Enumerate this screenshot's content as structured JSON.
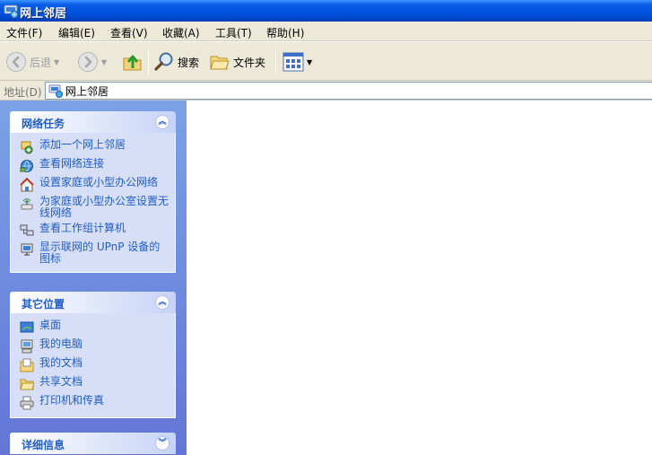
{
  "window": {
    "title": "网上邻居"
  },
  "menu": [
    {
      "label": "文件(F)"
    },
    {
      "label": "编辑(E)"
    },
    {
      "label": "查看(V)"
    },
    {
      "label": "收藏(A)"
    },
    {
      "label": "工具(T)"
    },
    {
      "label": "帮助(H)"
    }
  ],
  "toolbar": {
    "back_label": "后退",
    "search_label": "搜索",
    "folders_label": "文件夹"
  },
  "address": {
    "label": "地址(D)",
    "value": "网上邻居"
  },
  "panels": {
    "network_tasks": {
      "title": "网络任务",
      "items": [
        {
          "label": "添加一个网上邻居",
          "icon": "add-network-place-icon"
        },
        {
          "label": "查看网络连接",
          "icon": "network-connections-icon"
        },
        {
          "label": "设置家庭或小型办公网络",
          "icon": "home-network-setup-icon"
        },
        {
          "label": "为家庭或小型办公室设置无线网络",
          "icon": "wireless-network-setup-icon"
        },
        {
          "label": "查看工作组计算机",
          "icon": "workgroup-computers-icon"
        },
        {
          "label": "显示联网的 UPnP 设备的图标",
          "icon": "upnp-device-icon"
        }
      ]
    },
    "other_places": {
      "title": "其它位置",
      "items": [
        {
          "label": "桌面",
          "icon": "desktop-icon"
        },
        {
          "label": "我的电脑",
          "icon": "my-computer-icon"
        },
        {
          "label": "我的文档",
          "icon": "my-documents-icon"
        },
        {
          "label": "共享文档",
          "icon": "shared-documents-icon"
        },
        {
          "label": "打印机和传真",
          "icon": "printers-faxes-icon"
        }
      ]
    },
    "details": {
      "title": "详细信息"
    }
  },
  "colors": {
    "title_bar": "#0054e3",
    "task_link": "#215dc6",
    "task_pane": "#7ba2e7",
    "panel_body": "#d6dff7"
  }
}
